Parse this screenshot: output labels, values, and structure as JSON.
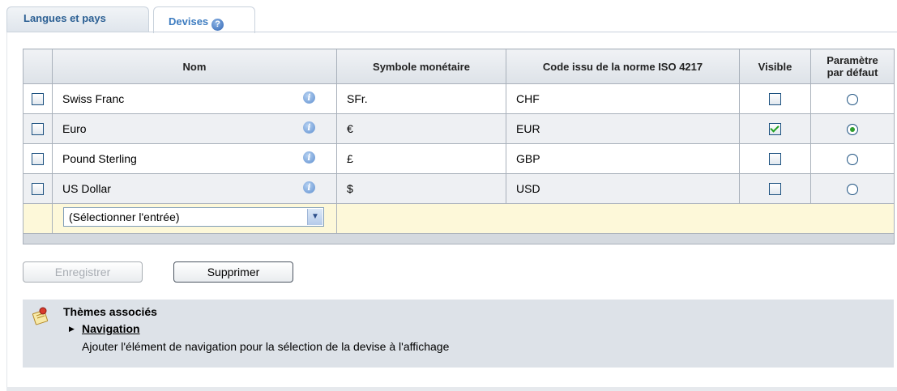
{
  "tabs": {
    "languages_label": "Langues et pays",
    "currencies_label": "Devises",
    "help_glyph": "?"
  },
  "table": {
    "headers": {
      "name": "Nom",
      "symbol": "Symbole monétaire",
      "code": "Code issu de la norme ISO 4217",
      "visible": "Visible",
      "default_line1": "Paramètre",
      "default_line2": "par défaut"
    },
    "info_glyph": "i",
    "rows": [
      {
        "name": "Swiss Franc",
        "symbol": "SFr.",
        "code": "CHF",
        "visible": false,
        "default": false
      },
      {
        "name": "Euro",
        "symbol": "€",
        "code": "EUR",
        "visible": true,
        "default": true
      },
      {
        "name": "Pound Sterling",
        "symbol": "£",
        "code": "GBP",
        "visible": false,
        "default": false
      },
      {
        "name": "US Dollar",
        "symbol": "$",
        "code": "USD",
        "visible": false,
        "default": false
      }
    ],
    "new_entry_select": "(Sélectionner l'entrée)"
  },
  "buttons": {
    "save": "Enregistrer",
    "delete": "Supprimer"
  },
  "related": {
    "title": "Thèmes associés",
    "link": "Navigation",
    "description": "Ajouter l'élément de navigation pour la sélection de la devise à l'affichage",
    "icon": "notepad-icon"
  }
}
